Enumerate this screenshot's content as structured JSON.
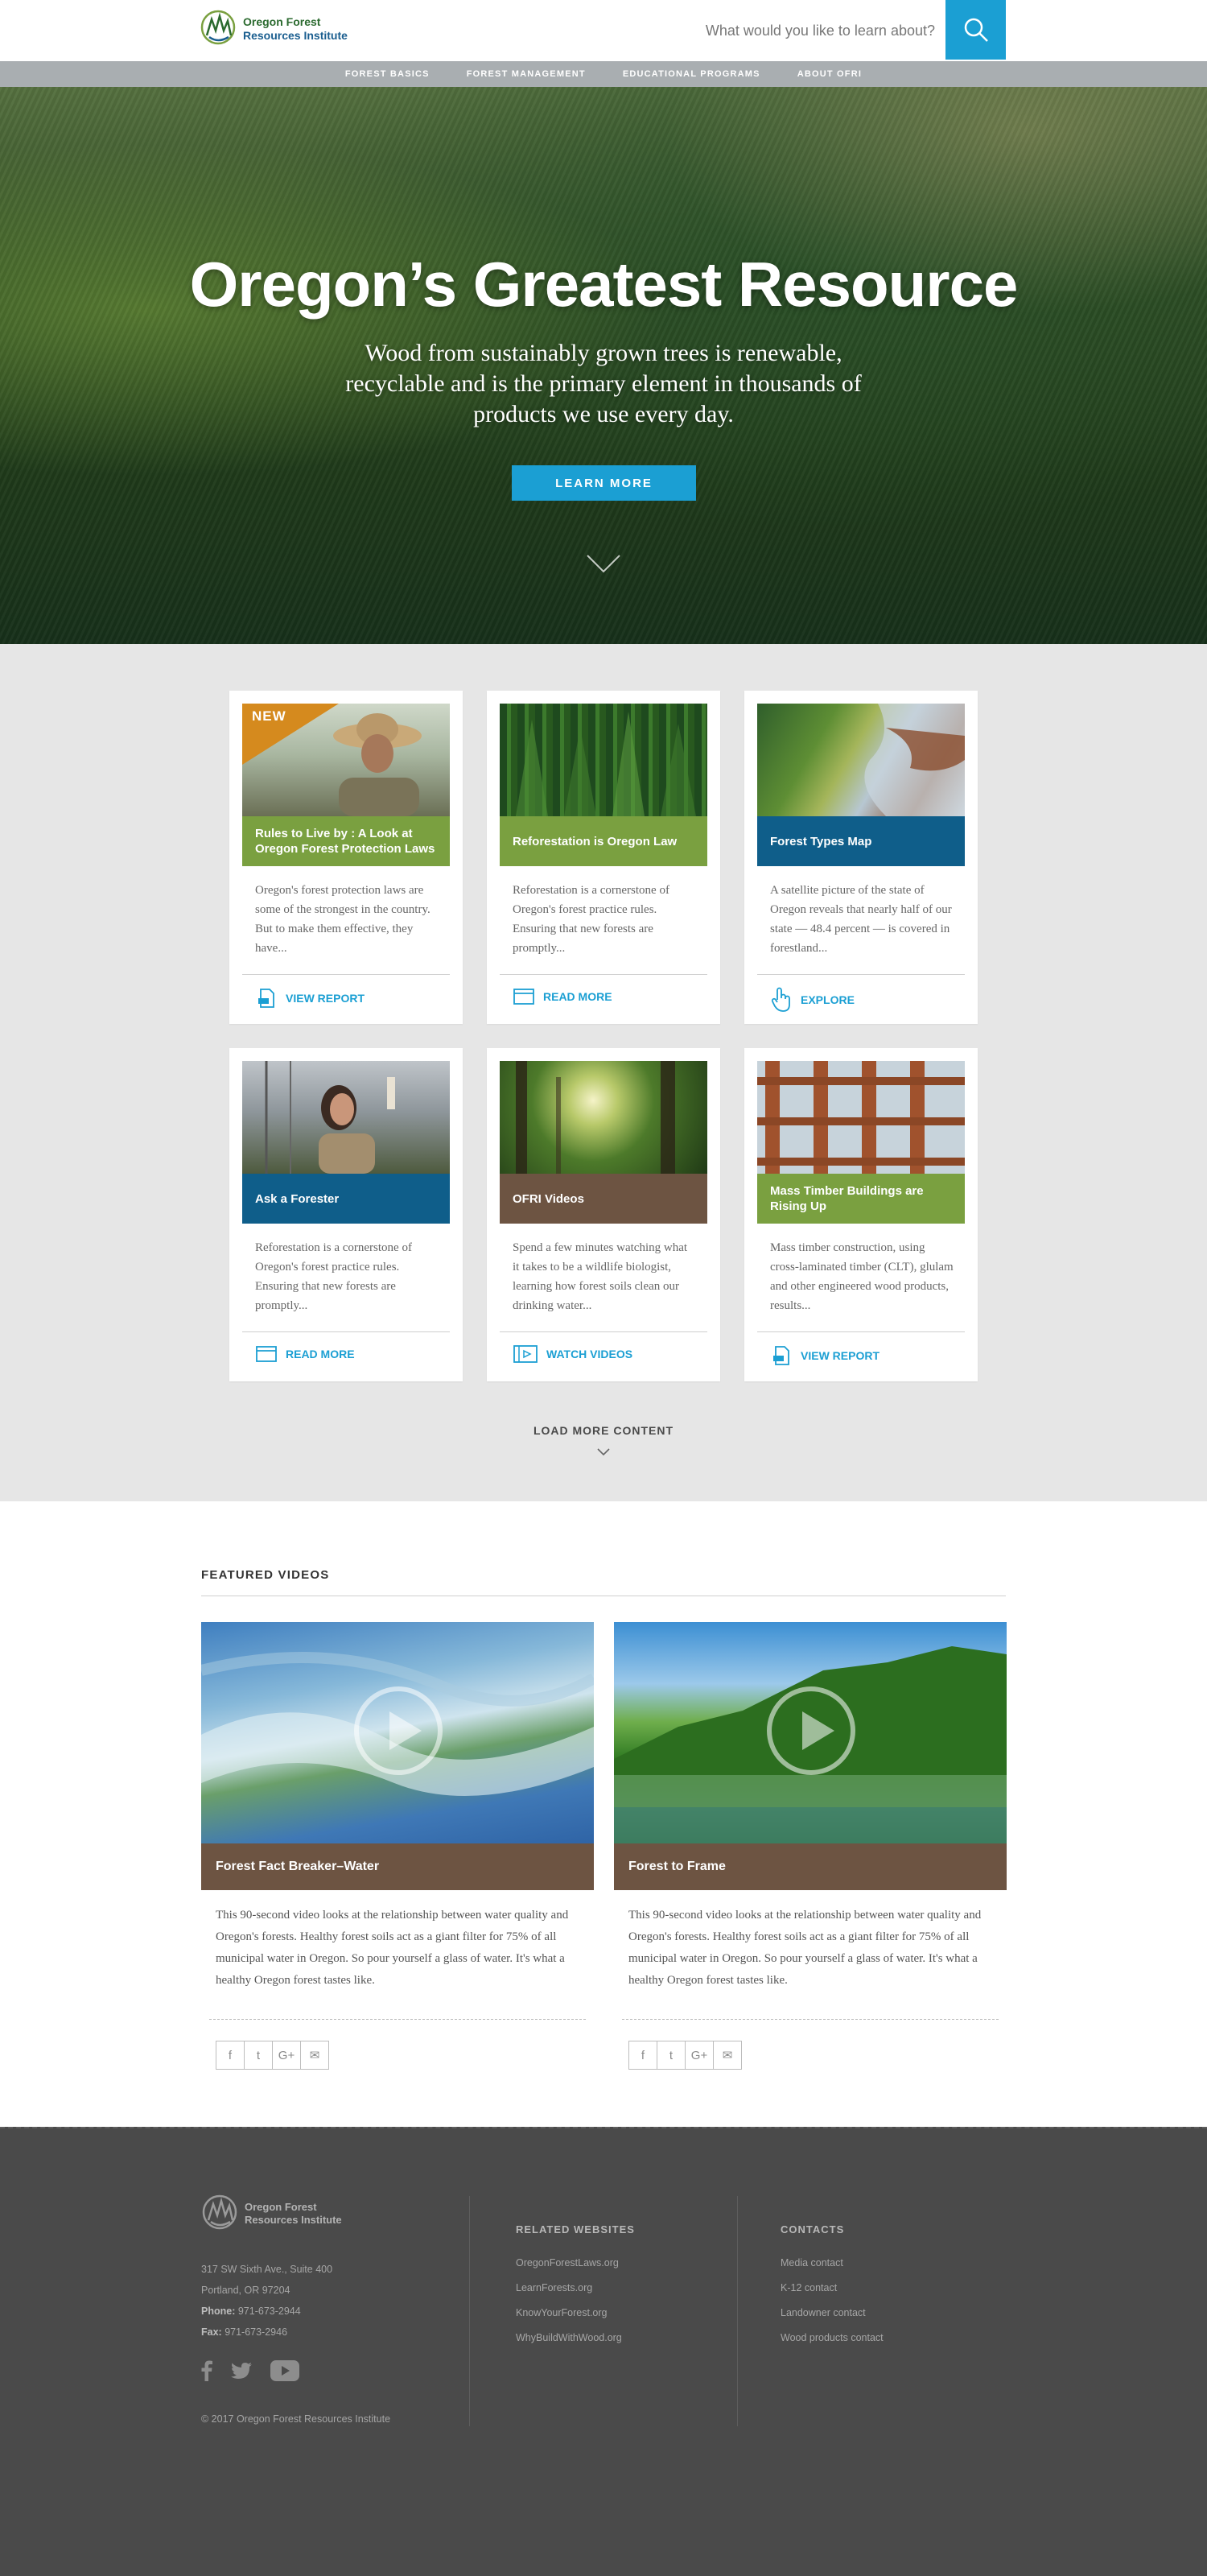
{
  "brand": {
    "line1": "Oregon Forest",
    "line2": "Resources Institute"
  },
  "search": {
    "placeholder": "What would you like to learn about?"
  },
  "nav": {
    "items": [
      {
        "label": "FOREST BASICS"
      },
      {
        "label": "FOREST MANAGEMENT"
      },
      {
        "label": "EDUCATIONAL PROGRAMS"
      },
      {
        "label": "ABOUT OFRI"
      }
    ]
  },
  "hero": {
    "title": "Oregon’s Greatest Resource",
    "subtitle": "Wood from sustainably grown trees is renewable, recyclable and is the primary element in thousands of products we use every day.",
    "button": "LEARN MORE"
  },
  "cards": [
    {
      "badge": "NEW",
      "title": "Rules to Live by : A Look at Oregon Forest Protection Laws",
      "desc": "Oregon's forest protection laws are some of the strongest in the country. But to make them effective, they have...",
      "action": "VIEW REPORT",
      "icon": "report-icon",
      "band": "green"
    },
    {
      "title": "Reforestation is Oregon Law",
      "desc": "Reforestation is a cornerstone of Oregon's forest practice rules. Ensuring that new forests are promptly...",
      "action": "READ MORE",
      "icon": "article-icon",
      "band": "green"
    },
    {
      "title": "Forest Types Map",
      "desc": "A satellite picture of the state of Oregon reveals that nearly half of our state — 48.4 percent — is covered in forestland...",
      "action": "EXPLORE",
      "icon": "pointer-hand-icon",
      "band": "blue"
    },
    {
      "title": "Ask a Forester",
      "desc": "Reforestation is a cornerstone of Oregon's forest practice rules. Ensuring that new forests are promptly...",
      "action": "READ MORE",
      "icon": "article-icon",
      "band": "blue"
    },
    {
      "title": "OFRI Videos",
      "desc": "Spend a few minutes watching what it takes to be a wildlife biologist, learning how forest soils clean our drinking water...",
      "action": "WATCH VIDEOS",
      "icon": "video-icon",
      "band": "brown"
    },
    {
      "title": "Mass Timber Buildings are Rising Up",
      "desc": "Mass timber construction, using cross-laminated timber (CLT), glulam and other engineered wood products, results...",
      "action": "VIEW REPORT",
      "icon": "report-icon",
      "band": "green"
    }
  ],
  "load_more": "LOAD MORE CONTENT",
  "featured": {
    "title": "FEATURED VIDEOS",
    "videos": [
      {
        "title": "Forest Fact Breaker–Water",
        "desc": "This 90-second video looks at the relationship between water quality and Oregon's forests. Healthy forest soils act as a giant filter for 75% of all municipal water in Oregon. So pour yourself a glass of water. It's what a healthy Oregon forest tastes like."
      },
      {
        "title": "Forest to Frame",
        "desc": "This 90-second video looks at the relationship between water quality and Oregon's forests. Healthy forest soils act as a giant filter for 75% of all municipal water in Oregon. So pour yourself a glass of water. It's what a healthy Oregon forest tastes like."
      }
    ],
    "share_icons": [
      "facebook-icon",
      "twitter-icon",
      "google-plus-icon",
      "email-icon"
    ],
    "share_glyphs": [
      "f",
      "t",
      "G+",
      "✉"
    ]
  },
  "footer": {
    "address1": "317 SW Sixth Ave., Suite 400",
    "address2": "Portland, OR 97204",
    "phone_label": "Phone:",
    "phone": "971-673-2944",
    "fax_label": "Fax:",
    "fax": "971-673-2946",
    "copyright": "© 2017 Oregon Forest Resources Institute",
    "related_title": "RELATED WEBSITES",
    "related": [
      "OregonForestLaws.org",
      "LearnForests.org",
      "KnowYourForest.org",
      "WhyBuildWithWood.org"
    ],
    "contacts_title": "CONTACTS",
    "contacts": [
      "Media contact",
      "K-12 contact",
      "Landowner contact",
      "Wood products contact"
    ]
  },
  "colors": {
    "accent": "#1b9fd3",
    "green_band": "#7aa040",
    "blue_band": "#0f5e8a",
    "brown_band": "#6d5442",
    "badge": "#d58a1e",
    "footer": "#4a4a4a"
  }
}
